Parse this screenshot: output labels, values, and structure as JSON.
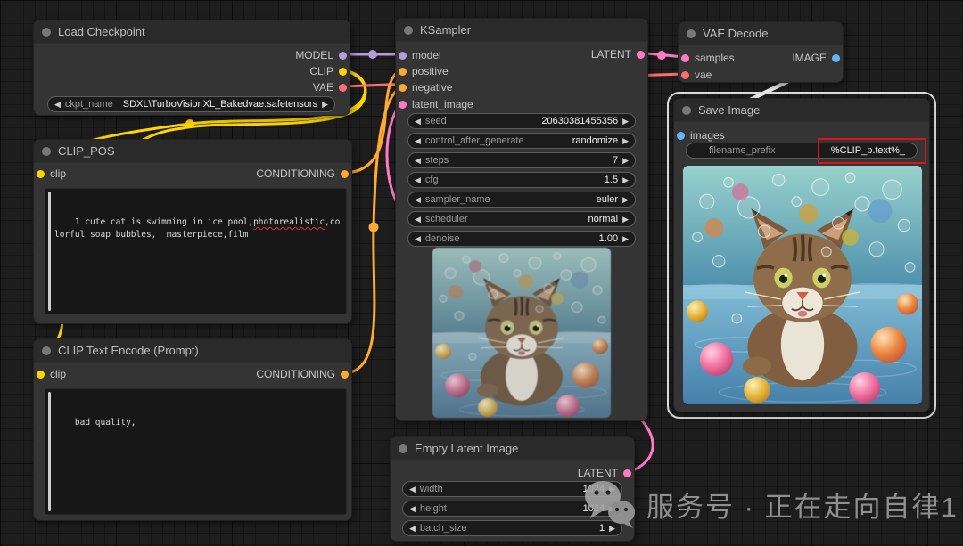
{
  "watermark": {
    "text": "服务号 · 正在走向自律1",
    "icon": "wechat-icon"
  },
  "colors": {
    "model": "#B39DDB",
    "clip": "#FFD500",
    "vae": "#FF6E6E",
    "conditioning": "#FFA931",
    "latent": "#FF7AC2",
    "image": "#64B5F6",
    "node_bg": "#343434",
    "title_bg": "#2a2a2a",
    "highlight_red": "#dd1212",
    "selection_white": "#dcdcdc"
  },
  "icons": [
    "collapse-dot",
    "left-arrow-icon",
    "right-arrow-icon",
    "wechat-icon"
  ],
  "nodes": {
    "load_checkpoint": {
      "title": "Load Checkpoint",
      "outputs": [
        "MODEL",
        "CLIP",
        "VAE"
      ],
      "widgets": [
        {
          "name": "ckpt_name",
          "value": "SDXL\\TurboVisionXL_Bakedvae.safetensors"
        }
      ]
    },
    "clip_pos": {
      "title": "CLIP_POS",
      "inputs": [
        "clip"
      ],
      "outputs": [
        "CONDITIONING"
      ],
      "text_before": "1 cute cat is swimming in ice pool,",
      "text_misspelled": "photorealistic",
      "text_after": ",colorful soap bubbles,  masterpiece,film"
    },
    "clip_neg": {
      "title": "CLIP Text Encode (Prompt)",
      "inputs": [
        "clip"
      ],
      "outputs": [
        "CONDITIONING"
      ],
      "text": "bad quality,"
    },
    "ksampler": {
      "title": "KSampler",
      "inputs": [
        "model",
        "positive",
        "negative",
        "latent_image"
      ],
      "outputs": [
        "LATENT"
      ],
      "widgets": [
        {
          "name": "seed",
          "value": "20630381455356"
        },
        {
          "name": "control_after_generate",
          "value": "randomize"
        },
        {
          "name": "steps",
          "value": "7"
        },
        {
          "name": "cfg",
          "value": "1.5"
        },
        {
          "name": "sampler_name",
          "value": "euler"
        },
        {
          "name": "scheduler",
          "value": "normal"
        },
        {
          "name": "denoise",
          "value": "1.00"
        }
      ]
    },
    "vae_decode": {
      "title": "VAE Decode",
      "inputs": [
        "samples",
        "vae"
      ],
      "outputs": [
        "IMAGE"
      ]
    },
    "save_image": {
      "title": "Save Image",
      "inputs": [
        "images"
      ],
      "widgets": [
        {
          "name": "filename_prefix",
          "value": "%CLIP_p.text%_"
        }
      ],
      "selected": true
    },
    "empty_latent": {
      "title": "Empty Latent Image",
      "outputs": [
        "LATENT"
      ],
      "widgets": [
        {
          "name": "width",
          "value": "1024"
        },
        {
          "name": "height",
          "value": "1024"
        },
        {
          "name": "batch_size",
          "value": "1"
        }
      ]
    }
  }
}
